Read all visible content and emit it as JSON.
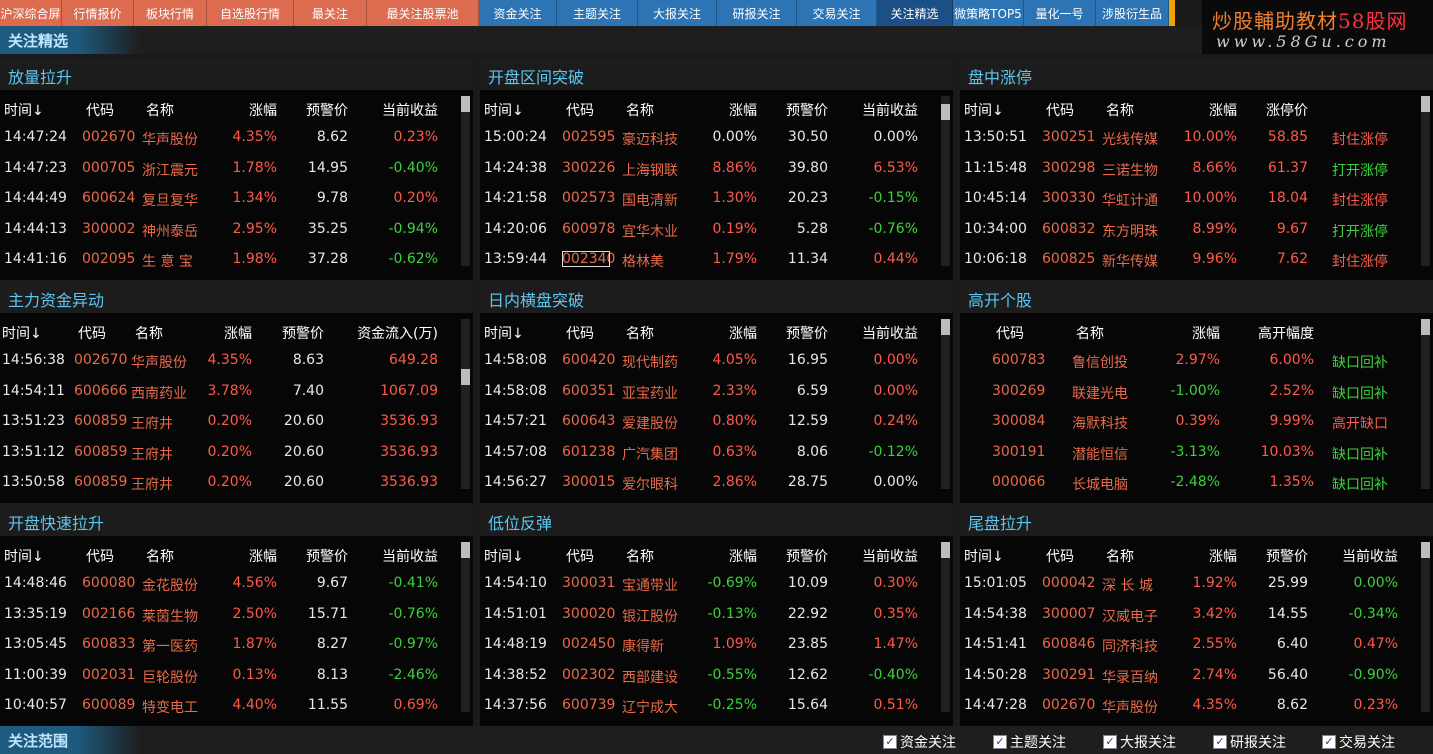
{
  "top_tabs": [
    {
      "label": "沪深综合屏",
      "style": "orange",
      "width": 62
    },
    {
      "label": "行情报价",
      "style": "orange",
      "width": 72
    },
    {
      "label": "板块行情",
      "style": "orange",
      "width": 73
    },
    {
      "label": "自选股行情",
      "style": "orange",
      "width": 87
    },
    {
      "label": "最关注",
      "style": "orange",
      "width": 73
    },
    {
      "label": "最关注股票池",
      "style": "orange",
      "width": 112
    },
    {
      "label": "资金关注",
      "style": "blue",
      "width": 78
    },
    {
      "label": "主题关注",
      "style": "blue",
      "width": 81
    },
    {
      "label": "大报关注",
      "style": "blue",
      "width": 79
    },
    {
      "label": "研报关注",
      "style": "blue",
      "width": 80
    },
    {
      "label": "交易关注",
      "style": "blue",
      "width": 80
    },
    {
      "label": "关注精选",
      "style": "active",
      "width": 76
    },
    {
      "label": "微策略TOP5",
      "style": "blue",
      "width": 71
    },
    {
      "label": "量化一号",
      "style": "blue",
      "width": 72
    },
    {
      "label": "涉股衍生品",
      "style": "blue",
      "width": 73
    }
  ],
  "logo": {
    "text_main": "炒股輔助教材",
    "text_brand": "58股网",
    "text_url": "www.58Gu.com"
  },
  "page_title": "关注精选",
  "panels": [
    {
      "title": "放量拉升",
      "headers": [
        "时间↓",
        "代码",
        "名称",
        "涨幅",
        "预警价",
        "当前收益"
      ],
      "rows": [
        {
          "time": "14:47:24",
          "code": "002670",
          "name": "华声股份",
          "change": "4.35%",
          "price": "8.62",
          "extra": "0.23%",
          "change_color": "red",
          "extra_color": "red"
        },
        {
          "time": "14:47:23",
          "code": "000705",
          "name": "浙江震元",
          "change": "1.78%",
          "price": "14.95",
          "extra": "-0.40%",
          "change_color": "red",
          "extra_color": "green"
        },
        {
          "time": "14:44:49",
          "code": "600624",
          "name": "复旦复华",
          "change": "1.34%",
          "price": "9.78",
          "extra": "0.20%",
          "change_color": "red",
          "extra_color": "red"
        },
        {
          "time": "14:44:13",
          "code": "300002",
          "name": "神州泰岳",
          "change": "2.95%",
          "price": "35.25",
          "extra": "-0.94%",
          "change_color": "red",
          "extra_color": "green"
        },
        {
          "time": "14:41:16",
          "code": "002095",
          "name": "生 意 宝",
          "change": "1.98%",
          "price": "37.28",
          "extra": "-0.62%",
          "change_color": "red",
          "extra_color": "green"
        }
      ]
    },
    {
      "title": "开盘区间突破",
      "headers": [
        "时间↓",
        "代码",
        "名称",
        "涨幅",
        "预警价",
        "当前收益"
      ],
      "rows": [
        {
          "time": "15:00:24",
          "code": "002595",
          "name": "豪迈科技",
          "change": "0.00%",
          "price": "30.50",
          "extra": "0.00%",
          "change_color": "white",
          "extra_color": "white"
        },
        {
          "time": "14:24:38",
          "code": "300226",
          "name": "上海钢联",
          "change": "8.86%",
          "price": "39.80",
          "extra": "6.53%",
          "change_color": "red",
          "extra_color": "red"
        },
        {
          "time": "14:21:58",
          "code": "002573",
          "name": "国电清新",
          "change": "1.30%",
          "price": "20.23",
          "extra": "-0.15%",
          "change_color": "red",
          "extra_color": "green"
        },
        {
          "time": "14:20:06",
          "code": "600978",
          "name": "宜华木业",
          "change": "0.19%",
          "price": "5.28",
          "extra": "-0.76%",
          "change_color": "red",
          "extra_color": "green"
        },
        {
          "time": "13:59:44",
          "code": "002340",
          "name": "格林美",
          "change": "1.79%",
          "price": "11.34",
          "extra": "0.44%",
          "change_color": "red",
          "extra_color": "red"
        }
      ]
    },
    {
      "title": "盘中涨停",
      "headers": [
        "时间↓",
        "代码",
        "名称",
        "涨幅",
        "涨停价",
        ""
      ],
      "rows": [
        {
          "time": "13:50:51",
          "code": "300251",
          "name": "光线传媒",
          "change": "10.00%",
          "price": "58.85",
          "extra": "封住涨停",
          "change_color": "red",
          "extra_color": "red",
          "price_color": "red"
        },
        {
          "time": "11:15:48",
          "code": "300298",
          "name": "三诺生物",
          "change": "8.66%",
          "price": "61.37",
          "extra": "打开涨停",
          "change_color": "red",
          "extra_color": "green",
          "price_color": "red"
        },
        {
          "time": "10:45:14",
          "code": "300330",
          "name": "华虹计通",
          "change": "10.00%",
          "price": "18.04",
          "extra": "封住涨停",
          "change_color": "red",
          "extra_color": "red",
          "price_color": "red"
        },
        {
          "time": "10:34:00",
          "code": "600832",
          "name": "东方明珠",
          "change": "8.99%",
          "price": "9.67",
          "extra": "打开涨停",
          "change_color": "red",
          "extra_color": "green",
          "price_color": "red"
        },
        {
          "time": "10:06:18",
          "code": "600825",
          "name": "新华传媒",
          "change": "9.96%",
          "price": "7.62",
          "extra": "封住涨停",
          "change_color": "red",
          "extra_color": "red",
          "price_color": "red"
        }
      ]
    },
    {
      "title": "主力资金异动",
      "headers": [
        "时间↓",
        "代码",
        "名称",
        "涨幅",
        "预警价",
        "资金流入(万)"
      ],
      "rows": [
        {
          "time": "14:56:38",
          "code": "002670",
          "name": "华声股份",
          "change": "4.35%",
          "price": "8.63",
          "extra": "649.28",
          "change_color": "red",
          "extra_color": "red"
        },
        {
          "time": "14:54:11",
          "code": "600666",
          "name": "西南药业",
          "change": "3.78%",
          "price": "7.40",
          "extra": "1067.09",
          "change_color": "red",
          "extra_color": "red"
        },
        {
          "time": "13:51:23",
          "code": "600859",
          "name": "王府井",
          "change": "0.20%",
          "price": "20.60",
          "extra": "3536.93",
          "change_color": "red",
          "extra_color": "red"
        },
        {
          "time": "13:51:12",
          "code": "600859",
          "name": "王府井",
          "change": "0.20%",
          "price": "20.60",
          "extra": "3536.93",
          "change_color": "red",
          "extra_color": "red"
        },
        {
          "time": "13:50:58",
          "code": "600859",
          "name": "王府井",
          "change": "0.20%",
          "price": "20.60",
          "extra": "3536.93",
          "change_color": "red",
          "extra_color": "red"
        }
      ]
    },
    {
      "title": "日内横盘突破",
      "headers": [
        "时间↓",
        "代码",
        "名称",
        "涨幅",
        "预警价",
        "当前收益"
      ],
      "rows": [
        {
          "time": "14:58:08",
          "code": "600420",
          "name": "现代制药",
          "change": "4.05%",
          "price": "16.95",
          "extra": "0.00%",
          "change_color": "red",
          "extra_color": "red"
        },
        {
          "time": "14:58:08",
          "code": "600351",
          "name": "亚宝药业",
          "change": "2.33%",
          "price": "6.59",
          "extra": "0.00%",
          "change_color": "red",
          "extra_color": "red"
        },
        {
          "time": "14:57:21",
          "code": "600643",
          "name": "爱建股份",
          "change": "0.80%",
          "price": "12.59",
          "extra": "0.24%",
          "change_color": "red",
          "extra_color": "red"
        },
        {
          "time": "14:57:08",
          "code": "601238",
          "name": "广汽集团",
          "change": "0.63%",
          "price": "8.06",
          "extra": "-0.12%",
          "change_color": "red",
          "extra_color": "green"
        },
        {
          "time": "14:56:27",
          "code": "300015",
          "name": "爱尔眼科",
          "change": "2.86%",
          "price": "28.75",
          "extra": "0.00%",
          "change_color": "red",
          "extra_color": "white"
        }
      ]
    },
    {
      "title": "高开个股",
      "headers": [
        "",
        "代码",
        "名称",
        "涨幅",
        "高开幅度",
        ""
      ],
      "rows": [
        {
          "time": "",
          "code": "600783",
          "name": "鲁信创投",
          "change": "2.97%",
          "price": "6.00%",
          "extra": "缺口回补",
          "change_color": "red",
          "extra_color": "green",
          "price_color": "red"
        },
        {
          "time": "",
          "code": "300269",
          "name": "联建光电",
          "change": "-1.00%",
          "price": "2.52%",
          "extra": "缺口回补",
          "change_color": "green",
          "extra_color": "green",
          "price_color": "red"
        },
        {
          "time": "",
          "code": "300084",
          "name": "海默科技",
          "change": "0.39%",
          "price": "9.99%",
          "extra": "高开缺口",
          "change_color": "red",
          "extra_color": "red",
          "price_color": "red"
        },
        {
          "time": "",
          "code": "300191",
          "name": "潜能恒信",
          "change": "-3.13%",
          "price": "10.03%",
          "extra": "缺口回补",
          "change_color": "green",
          "extra_color": "green",
          "price_color": "red"
        },
        {
          "time": "",
          "code": "000066",
          "name": "长城电脑",
          "change": "-2.48%",
          "price": "1.35%",
          "extra": "缺口回补",
          "change_color": "green",
          "extra_color": "green",
          "price_color": "red"
        }
      ]
    },
    {
      "title": "开盘快速拉升",
      "headers": [
        "时间↓",
        "代码",
        "名称",
        "涨幅",
        "预警价",
        "当前收益"
      ],
      "rows": [
        {
          "time": "14:48:46",
          "code": "600080",
          "name": "金花股份",
          "change": "4.56%",
          "price": "9.67",
          "extra": "-0.41%",
          "change_color": "red",
          "extra_color": "green"
        },
        {
          "time": "13:35:19",
          "code": "002166",
          "name": "莱茵生物",
          "change": "2.50%",
          "price": "15.71",
          "extra": "-0.76%",
          "change_color": "red",
          "extra_color": "green"
        },
        {
          "time": "13:05:45",
          "code": "600833",
          "name": "第一医药",
          "change": "1.87%",
          "price": "8.27",
          "extra": "-0.97%",
          "change_color": "red",
          "extra_color": "green"
        },
        {
          "time": "11:00:39",
          "code": "002031",
          "name": "巨轮股份",
          "change": "0.13%",
          "price": "8.13",
          "extra": "-2.46%",
          "change_color": "red",
          "extra_color": "green"
        },
        {
          "time": "10:40:57",
          "code": "600089",
          "name": "特变电工",
          "change": "4.40%",
          "price": "11.55",
          "extra": "0.69%",
          "change_color": "red",
          "extra_color": "red"
        }
      ]
    },
    {
      "title": "低位反弹",
      "headers": [
        "时间↓",
        "代码",
        "名称",
        "涨幅",
        "预警价",
        "当前收益"
      ],
      "rows": [
        {
          "time": "14:54:10",
          "code": "300031",
          "name": "宝通带业",
          "change": "-0.69%",
          "price": "10.09",
          "extra": "0.30%",
          "change_color": "green",
          "extra_color": "red"
        },
        {
          "time": "14:51:01",
          "code": "300020",
          "name": "银江股份",
          "change": "-0.13%",
          "price": "22.92",
          "extra": "0.35%",
          "change_color": "green",
          "extra_color": "red"
        },
        {
          "time": "14:48:19",
          "code": "002450",
          "name": "康得新",
          "change": "1.09%",
          "price": "23.85",
          "extra": "1.47%",
          "change_color": "red",
          "extra_color": "red"
        },
        {
          "time": "14:38:52",
          "code": "002302",
          "name": "西部建设",
          "change": "-0.55%",
          "price": "12.62",
          "extra": "-0.40%",
          "change_color": "green",
          "extra_color": "green"
        },
        {
          "time": "14:37:56",
          "code": "600739",
          "name": "辽宁成大",
          "change": "-0.25%",
          "price": "15.64",
          "extra": "0.51%",
          "change_color": "green",
          "extra_color": "red"
        }
      ]
    },
    {
      "title": "尾盘拉升",
      "headers": [
        "时间↓",
        "代码",
        "名称",
        "涨幅",
        "预警价",
        "当前收益"
      ],
      "rows": [
        {
          "time": "15:01:05",
          "code": "000042",
          "name": "深 长 城",
          "change": "1.92%",
          "price": "25.99",
          "extra": "0.00%",
          "change_color": "red",
          "extra_color": "green"
        },
        {
          "time": "14:54:38",
          "code": "300007",
          "name": "汉威电子",
          "change": "3.42%",
          "price": "14.55",
          "extra": "-0.34%",
          "change_color": "red",
          "extra_color": "green"
        },
        {
          "time": "14:51:41",
          "code": "600846",
          "name": "同济科技",
          "change": "2.55%",
          "price": "6.40",
          "extra": "0.47%",
          "change_color": "red",
          "extra_color": "red"
        },
        {
          "time": "14:50:28",
          "code": "300291",
          "name": "华录百纳",
          "change": "2.74%",
          "price": "56.40",
          "extra": "-0.90%",
          "change_color": "red",
          "extra_color": "green"
        },
        {
          "time": "14:47:28",
          "code": "002670",
          "name": "华声股份",
          "change": "4.35%",
          "price": "8.62",
          "extra": "0.23%",
          "change_color": "red",
          "extra_color": "red"
        }
      ]
    }
  ],
  "bottom": {
    "title": "关注范围",
    "checkboxes": [
      {
        "label": "资金关注",
        "checked": true
      },
      {
        "label": "主题关注",
        "checked": true
      },
      {
        "label": "大报关注",
        "checked": true
      },
      {
        "label": "研报关注",
        "checked": true
      },
      {
        "label": "交易关注",
        "checked": true
      }
    ]
  },
  "colors": {
    "red": "#ff5a4a",
    "green": "#3cd23c",
    "white": "#e8e8e8",
    "code": "#e86a4a",
    "title": "#5cc6f0"
  }
}
